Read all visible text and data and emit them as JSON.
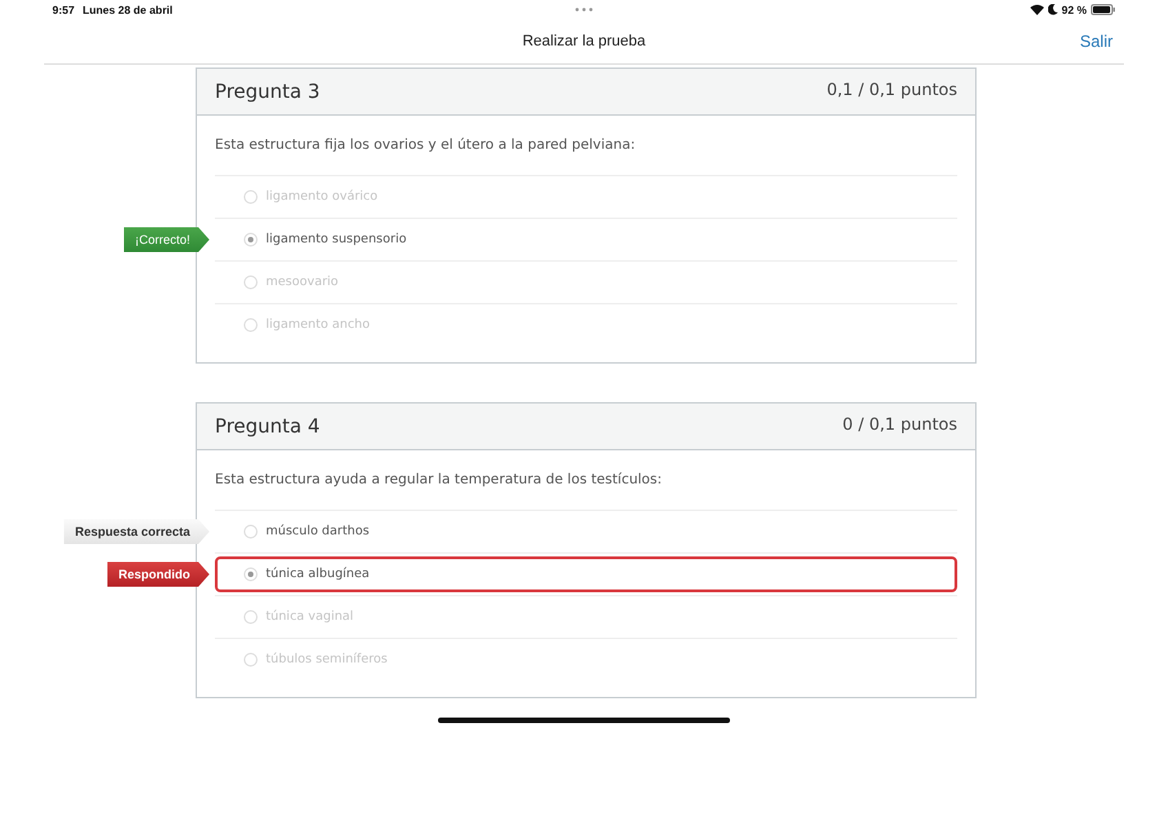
{
  "status_bar": {
    "time": "9:57",
    "date": "Lunes 28 de abril",
    "battery": "92 %"
  },
  "nav": {
    "title": "Realizar la prueba",
    "action": "Salir"
  },
  "questions": [
    {
      "title": "Pregunta 3",
      "points": "0,1 / 0,1 puntos",
      "text": "Esta estructura fija los ovarios y el útero a la pared pelviana:",
      "answers": [
        {
          "label": "ligamento ovárico",
          "selected": false
        },
        {
          "label": "ligamento suspensorio",
          "selected": true,
          "flag": {
            "kind": "correct",
            "text": "¡Correcto!"
          }
        },
        {
          "label": "mesoovario",
          "selected": false
        },
        {
          "label": "ligamento ancho",
          "selected": false
        }
      ]
    },
    {
      "title": "Pregunta 4",
      "points": "0 / 0,1 puntos",
      "text": "Esta estructura ayuda a regular la temperatura de los testículos:",
      "answers": [
        {
          "label": "músculo darthos",
          "selected": false,
          "flag": {
            "kind": "right_answer",
            "text": "Respuesta correcta"
          }
        },
        {
          "label": "túnica albugínea",
          "selected": true,
          "flag": {
            "kind": "answered",
            "text": "Respondido"
          }
        },
        {
          "label": "túnica vaginal",
          "selected": false
        },
        {
          "label": "túbulos seminíferos",
          "selected": false
        }
      ]
    }
  ]
}
